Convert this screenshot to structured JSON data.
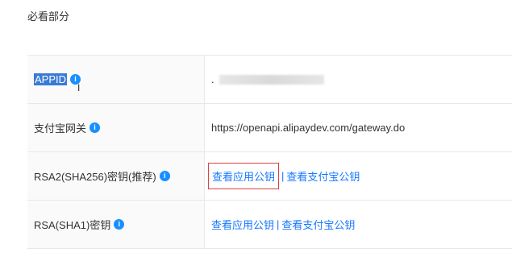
{
  "section": {
    "title": "必看部分"
  },
  "rows": [
    {
      "label": "APPID",
      "value_prefix": "."
    },
    {
      "label": "支付宝网关",
      "value": "https://openapi.alipaydev.com/gateway.do"
    },
    {
      "label": "RSA2(SHA256)密钥(推荐)",
      "link1": "查看应用公钥",
      "separator": "|",
      "link2": "查看支付宝公钥"
    },
    {
      "label": "RSA(SHA1)密钥",
      "link1": "查看应用公钥",
      "separator": "|",
      "link2": "查看支付宝公钥"
    }
  ],
  "icons": {
    "info": "i"
  },
  "colors": {
    "link": "#1677ff",
    "info_icon": "#1890ff",
    "highlight_box": "#d94141"
  }
}
